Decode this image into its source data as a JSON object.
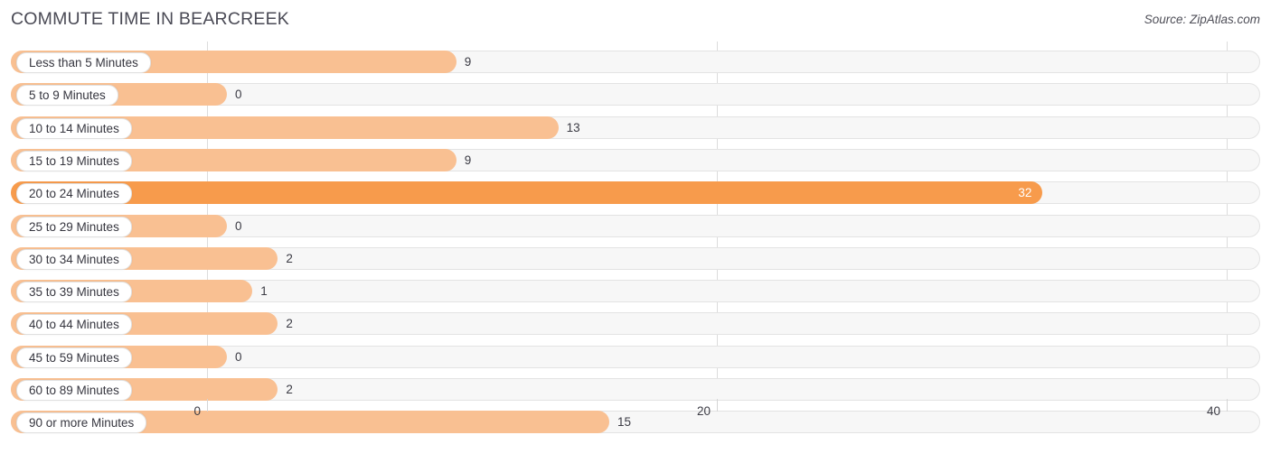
{
  "header": {
    "title": "COMMUTE TIME IN BEARCREEK",
    "source": "Source: ZipAtlas.com"
  },
  "colors": {
    "bar": "#f9c092",
    "bar_highlight": "#f79b4c",
    "track": "#f7f7f7",
    "track_border": "#e3e3e3",
    "gridline": "#dcdcdc",
    "text": "#3b3b44"
  },
  "chart_data": {
    "type": "bar",
    "orientation": "horizontal",
    "title": "COMMUTE TIME IN BEARCREEK",
    "xlabel": "",
    "ylabel": "",
    "xlim": [
      0,
      40
    ],
    "xticks": [
      "0",
      "20",
      "40"
    ],
    "xtick_values": [
      0,
      20,
      40
    ],
    "grid": true,
    "legend": false,
    "highlight_category": "20 to 24 Minutes",
    "categories": [
      "Less than 5 Minutes",
      "5 to 9 Minutes",
      "10 to 14 Minutes",
      "15 to 19 Minutes",
      "20 to 24 Minutes",
      "25 to 29 Minutes",
      "30 to 34 Minutes",
      "35 to 39 Minutes",
      "40 to 44 Minutes",
      "45 to 59 Minutes",
      "60 to 89 Minutes",
      "90 or more Minutes"
    ],
    "values": [
      9,
      0,
      13,
      9,
      32,
      0,
      2,
      1,
      2,
      0,
      2,
      15
    ],
    "value_labels": [
      "9",
      "0",
      "13",
      "9",
      "32",
      "0",
      "2",
      "1",
      "2",
      "0",
      "2",
      "15"
    ]
  }
}
